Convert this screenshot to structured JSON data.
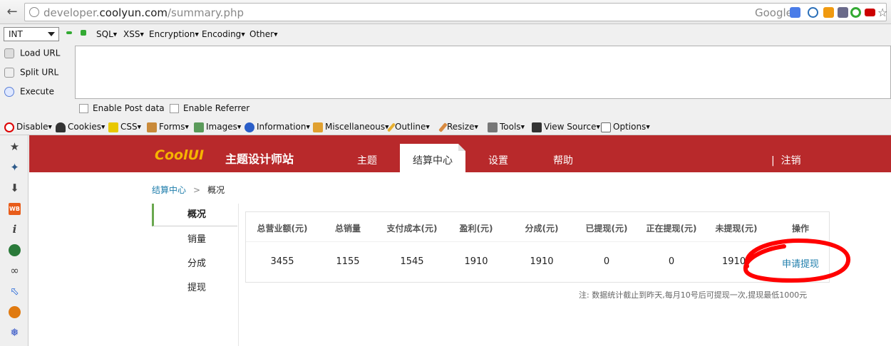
{
  "browser": {
    "url_prefix": "developer.",
    "url_host": "coolyun.com",
    "url_path": "/summary.php",
    "search_engine": "Google"
  },
  "hackbar": {
    "type_select": "INT",
    "menus": [
      "SQL",
      "XSS",
      "Encryption",
      "Encoding",
      "Other"
    ],
    "load_url": "Load URL",
    "split_url": "Split URL",
    "execute": "Execute",
    "enable_post": "Enable Post data",
    "enable_referrer": "Enable Referrer"
  },
  "webdev": {
    "items": [
      "Disable",
      "Cookies",
      "CSS",
      "Forms",
      "Images",
      "Information",
      "Miscellaneous",
      "Outline",
      "Resize",
      "Tools",
      "View Source",
      "Options"
    ]
  },
  "site": {
    "logo_text": "CoolUI",
    "logo_sub": "主题设计师站",
    "nav": {
      "theme": "主题",
      "settle": "结算中心",
      "settings": "设置",
      "help": "帮助"
    },
    "logout_sep": "|",
    "logout": "注销"
  },
  "breadcrumb": {
    "root": "结算中心",
    "sep": ">",
    "current": "概况"
  },
  "left_menu": [
    "概况",
    "销量",
    "分成",
    "提现"
  ],
  "table": {
    "headers": [
      "总营业额(元)",
      "总销量",
      "支付成本(元)",
      "盈利(元)",
      "分成(元)",
      "已提现(元)",
      "正在提现(元)",
      "未提现(元)",
      "操作"
    ],
    "row": [
      "3455",
      "1155",
      "1545",
      "1910",
      "1910",
      "0",
      "0",
      "1910"
    ],
    "action": "申请提现"
  },
  "note": "注:  数据统计截止到昨天,每月10号后可提现一次,提现最低1000元",
  "colors": {
    "header_red": "#b8292b",
    "link_blue": "#1e7dab",
    "annotation_red": "#ff0000"
  }
}
